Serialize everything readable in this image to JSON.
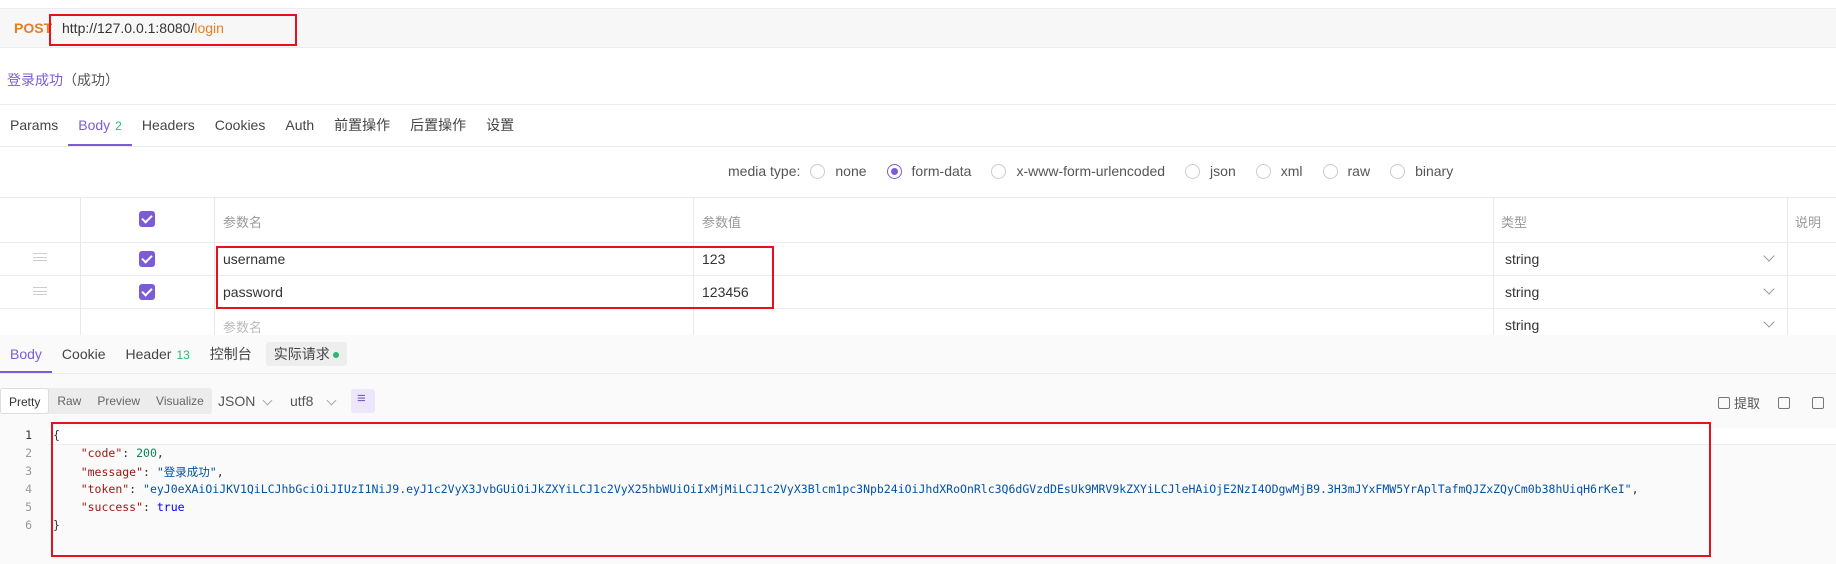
{
  "request": {
    "method": "POST",
    "url_base": "http://127.0.0.1:8080/",
    "url_path": "login"
  },
  "status": {
    "name": "登录成功",
    "result": "（成功）"
  },
  "req_tabs": [
    {
      "label": "Params",
      "count": ""
    },
    {
      "label": "Body",
      "count": "2"
    },
    {
      "label": "Headers",
      "count": ""
    },
    {
      "label": "Cookies",
      "count": ""
    },
    {
      "label": "Auth",
      "count": ""
    },
    {
      "label": "前置操作",
      "count": ""
    },
    {
      "label": "后置操作",
      "count": ""
    },
    {
      "label": "设置",
      "count": ""
    }
  ],
  "media": {
    "label": "media type:",
    "options": [
      "none",
      "form-data",
      "x-www-form-urlencoded",
      "json",
      "xml",
      "raw",
      "binary"
    ],
    "selected": "form-data"
  },
  "table": {
    "headers": {
      "name": "参数名",
      "value": "参数值",
      "type": "类型",
      "desc": "说明"
    },
    "rows": [
      {
        "name": "username",
        "value": "123",
        "type": "string"
      },
      {
        "name": "password",
        "value": "123456",
        "type": "string"
      }
    ],
    "new_row": {
      "name_placeholder": "参数名",
      "type": "string"
    }
  },
  "resp_tabs": [
    {
      "label": "Body",
      "count": ""
    },
    {
      "label": "Cookie",
      "count": ""
    },
    {
      "label": "Header",
      "count": "13"
    },
    {
      "label": "控制台",
      "count": ""
    },
    {
      "label": "实际请求",
      "count": ""
    }
  ],
  "format": {
    "modes": [
      "Pretty",
      "Raw",
      "Preview",
      "Visualize"
    ],
    "active": "Pretty",
    "lang": "JSON",
    "encoding": "utf8"
  },
  "actions": {
    "extract": "提取"
  },
  "code": {
    "line_numbers": [
      "1",
      "2",
      "3",
      "4",
      "5",
      "6"
    ],
    "code_key": "\"code\"",
    "code_val": "200",
    "message_key": "\"message\"",
    "message_val": "\"登录成功\"",
    "token_key": "\"token\"",
    "token_val": "\"eyJ0eXAiOiJKV1QiLCJhbGciOiJIUzI1NiJ9.eyJ1c2VyX3JvbGUiOiJkZXYiLCJ1c2VyX25hbWUiOiIxMjMiLCJ1c2VyX3Blcm1pc3Npb24iOiJhdXRoOnRlc3Q6dGVzdDEsUk9MRV9kZXYiLCJleHAiOjE2NzI4ODgwMjB9.3H3mJYxFMW5YrAplTafmQJZxZQyCm0b38hUiqH6rKeI\"",
    "success_key": "\"success\"",
    "success_val": "true",
    "open": "{",
    "close": "}"
  }
}
